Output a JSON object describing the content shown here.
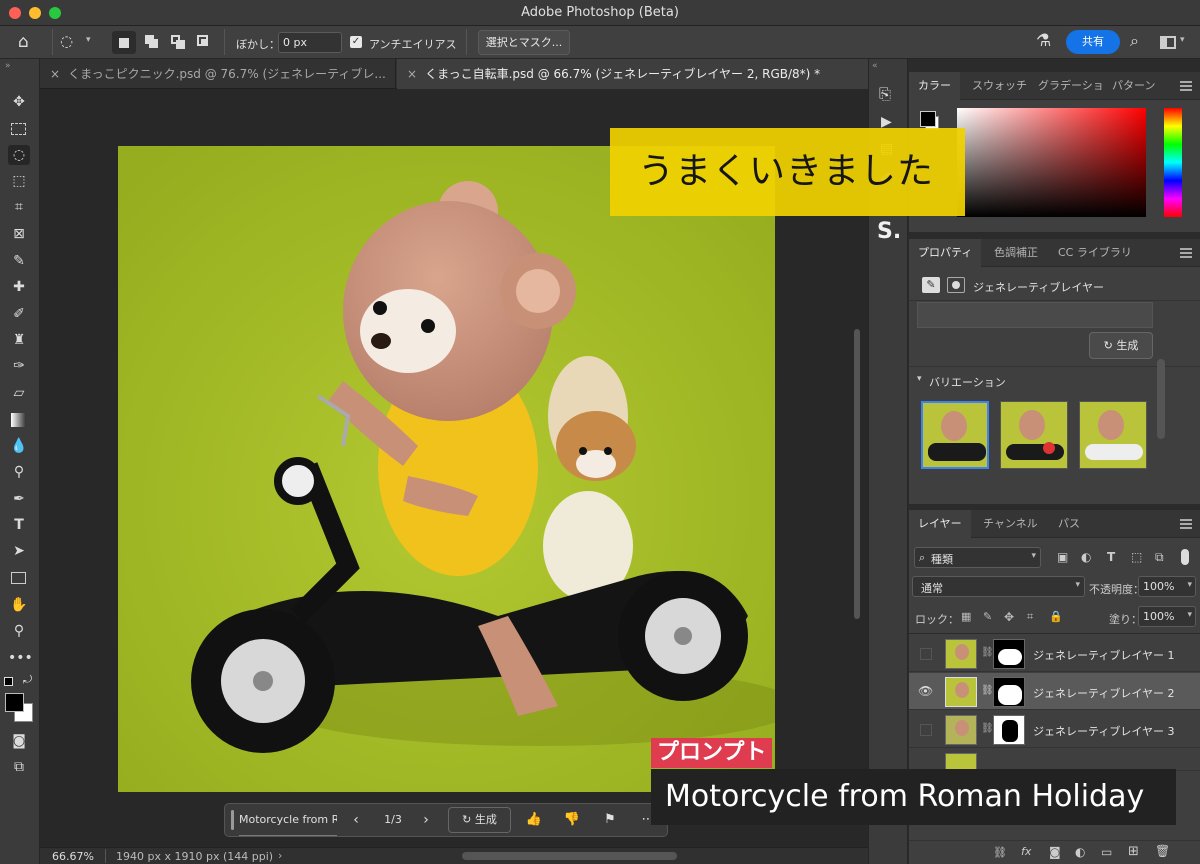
{
  "window": {
    "title": "Adobe Photoshop (Beta)"
  },
  "options": {
    "feather_label": "ぼかし：",
    "feather_value": "0 px",
    "antialias_label": "アンチエイリアス",
    "select_mask_label": "選択とマスク...",
    "share_label": "共有"
  },
  "tabs": [
    {
      "label": "くまっこピクニック.psd @ 76.7% (ジェネレーティブレ..."
    },
    {
      "label": "くまっこ自転車.psd @ 66.7% (ジェネレーティブレイヤー 2, RGB/8*) *"
    }
  ],
  "color_panel": {
    "tabs": [
      "カラー",
      "スウォッチ",
      "グラデーショ",
      "パターン"
    ]
  },
  "properties_panel": {
    "tabs": [
      "プロパティ",
      "色調補正",
      "CC ライブラリ"
    ],
    "layer_type": "ジェネレーティブレイヤー",
    "generate_label": "生成",
    "variations_label": "バリエーション"
  },
  "layers_panel": {
    "tabs": [
      "レイヤー",
      "チャンネル",
      "パス"
    ],
    "filter_label": "種類",
    "blend_mode": "通常",
    "opacity_label": "不透明度：",
    "opacity_value": "100%",
    "lock_label": "ロック：",
    "fill_label": "塗り：",
    "fill_value": "100%",
    "layers": [
      {
        "name": "ジェネレーティブレイヤー 1",
        "visible": false
      },
      {
        "name": "ジェネレーティブレイヤー 2",
        "visible": true
      },
      {
        "name": "ジェネレーティブレイヤー 3",
        "visible": false
      }
    ]
  },
  "genbar": {
    "prompt": "Motorcycle from R",
    "counter": "1/3",
    "generate_label": "生成"
  },
  "status": {
    "zoom": "66.67%",
    "doc_info": "1940 px x 1910 px (144 ppi)"
  },
  "overlays": {
    "banner": "うまくいきました",
    "prompt_label": "プロンプト",
    "prompt_text": "Motorcycle from Roman Holiday"
  },
  "colors": {
    "accent": "#1473e6",
    "banner": "#f0d200",
    "prompt_red": "#e03c50"
  }
}
